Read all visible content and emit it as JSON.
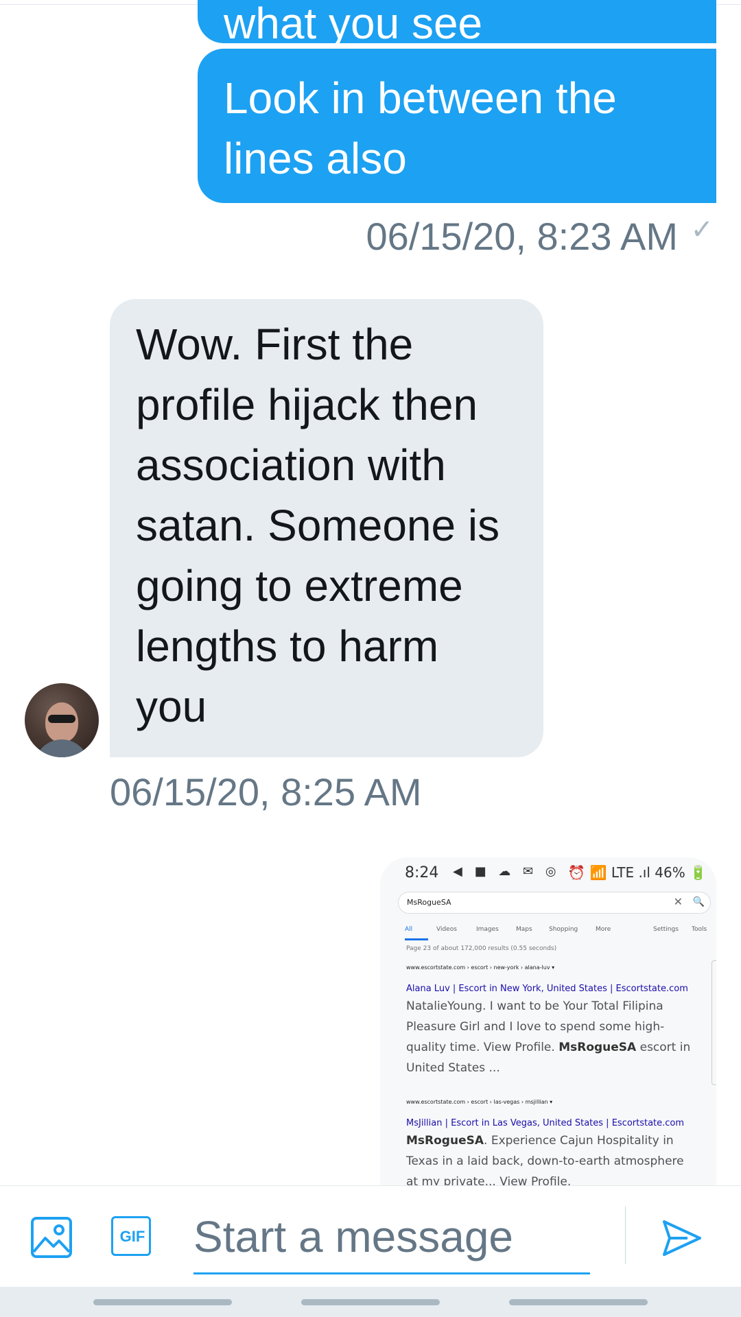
{
  "messages": {
    "prev_outgoing": "what you see",
    "outgoing_text": "Look in between the lines also",
    "outgoing_time": "06/15/20, 8:23 AM",
    "outgoing_check": "✓",
    "incoming_text": "Wow. First the profile hijack then association with satan.  Someone is going to extreme lengths to harm you",
    "incoming_time": "06/15/20, 8:25 AM"
  },
  "screenshot": {
    "status_time": "8:24",
    "status_icons": "◀ ■ ☁ ✉ ◎ ··",
    "status_right": "⏰ 📶 LTE .ıl 46% 🔋",
    "search_query": "MsRogueSA",
    "tabs": [
      "All",
      "Videos",
      "Images",
      "Maps",
      "Shopping",
      "More",
      "Settings",
      "Tools"
    ],
    "stats": "Page 23 of about 172,000 results (0.55 seconds)",
    "results": [
      {
        "url": "www.escortstate.com › escort › new-york › alana-luv ▾",
        "title": "Alana Luv | Escort in New York, United States | Escortstate.com",
        "snippet_pre": "NatalieYoung. I want to be Your Total Filipina Pleasure Girl and I love to spend some high-quality time. View Profile. ",
        "snippet_bold": "MsRogueSA",
        "snippet_post": " escort in United States ..."
      },
      {
        "url": "www.escortstate.com › escort › las-vegas › msjillian ▾",
        "title": "MsJillian | Escort in Las Vegas, United States | Escortstate.com",
        "snippet_bold": "MsRogueSA",
        "snippet_post": ". Experience Cajun Hospitality in Texas in a laid back, down-to-earth atmosphere at my private... View Profile."
      }
    ]
  },
  "composer": {
    "placeholder": "Start a message",
    "image_icon": "image-icon",
    "gif_label": "GIF",
    "send_icon": "send-icon"
  },
  "colors": {
    "accent": "#1da1f2",
    "incoming_bubble": "#e6ecf0",
    "timestamp": "#657786"
  }
}
